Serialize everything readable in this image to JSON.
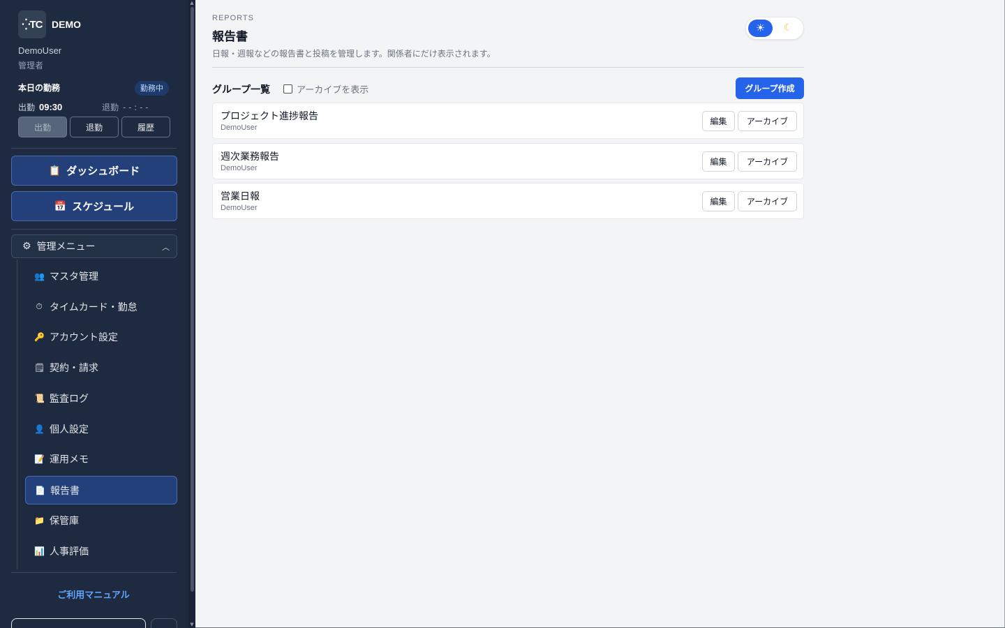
{
  "sidebar": {
    "logo_text": "⁛TC",
    "brand": "DEMO",
    "user_name": "DemoUser",
    "user_role": "管理者",
    "attendance": {
      "title": "本日の勤務",
      "status_badge": "勤務中",
      "clock_in_label": "出勤",
      "clock_in_time": "09:30",
      "clock_out_label": "退勤",
      "clock_out_time": "- - : - -",
      "buttons": {
        "clock_in": "出勤",
        "clock_out": "退勤",
        "history": "履歴"
      }
    },
    "dashboard_label": "ダッシュボード",
    "schedule_label": "スケジュール",
    "admin_menu": {
      "label": "管理メニュー",
      "items": [
        {
          "label": "マスタ管理",
          "icon": "people-icon"
        },
        {
          "label": "タイムカード・勤怠",
          "icon": "stopwatch-icon"
        },
        {
          "label": "アカウント設定",
          "icon": "key-icon"
        },
        {
          "label": "契約・請求",
          "icon": "document-icon"
        },
        {
          "label": "監査ログ",
          "icon": "scroll-icon"
        },
        {
          "label": "個人設定",
          "icon": "person-icon"
        },
        {
          "label": "運用メモ",
          "icon": "memo-icon"
        },
        {
          "label": "報告書",
          "icon": "page-icon",
          "active": true
        },
        {
          "label": "保管庫",
          "icon": "folder-icon"
        },
        {
          "label": "人事評価",
          "icon": "chart-icon"
        }
      ]
    },
    "manual_link": "ご利用マニュアル"
  },
  "main": {
    "kicker": "REPORTS",
    "title": "報告書",
    "description": "日報・週報などの報告書と投稿を管理します。関係者にだけ表示されます。",
    "group_list_title": "グループ一覧",
    "show_archived_label": "アーカイブを表示",
    "create_group_button": "グループ作成",
    "groups": [
      {
        "name": "プロジェクト進捗報告",
        "owner": "DemoUser",
        "edit": "編集",
        "archive": "アーカイブ"
      },
      {
        "name": "週次業務報告",
        "owner": "DemoUser",
        "edit": "編集",
        "archive": "アーカイブ"
      },
      {
        "name": "営業日報",
        "owner": "DemoUser",
        "edit": "編集",
        "archive": "アーカイブ"
      }
    ]
  },
  "colors": {
    "sidebar_bg": "#1e2a3f",
    "accent": "#2563eb",
    "active_nav": "#24407a",
    "link": "#60a5fa"
  }
}
